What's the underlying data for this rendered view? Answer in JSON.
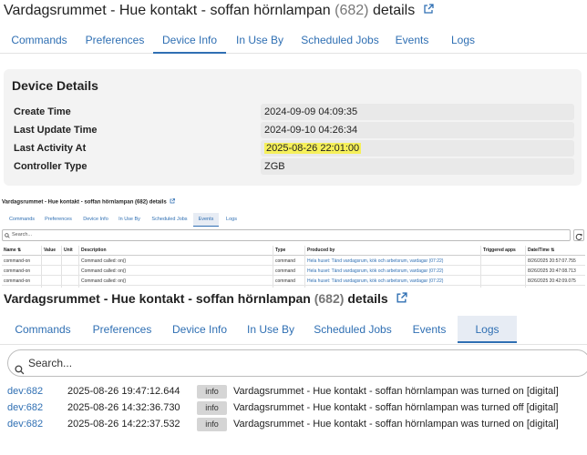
{
  "panel1": {
    "title": "Vardagsrummet - Hue kontakt - soffan hörnlampan",
    "count": "(682)",
    "title_suffix": "details",
    "tabs": [
      "Commands",
      "Preferences",
      "Device Info",
      "In Use By",
      "Scheduled Jobs",
      "Events",
      "Logs"
    ],
    "active_tab": "Device Info",
    "card_title": "Device Details",
    "details": [
      {
        "label": "Create Time",
        "value": "2024-09-09 04:09:35"
      },
      {
        "label": "Last Update Time",
        "value": "2024-09-10 04:26:34"
      },
      {
        "label": "Last Activity At",
        "value": "2025-08-26 22:01:00"
      },
      {
        "label": "Controller Type",
        "value": "ZGB"
      }
    ],
    "highlight_color": "#f6f05a"
  },
  "panel2": {
    "title": "Vardagsrummet - Hue kontakt - soffan hörnlampan (682) details",
    "tabs": [
      "Commands",
      "Preferences",
      "Device Info",
      "In Use By",
      "Scheduled Jobs",
      "Events",
      "Logs"
    ],
    "active_tab": "Events",
    "search_placeholder": "Search...",
    "columns": [
      "Name",
      "Value",
      "Unit",
      "Description",
      "Type",
      "Produced by",
      "Triggered apps",
      "Date/Time"
    ],
    "rows": [
      {
        "name": "command-on",
        "value": "",
        "unit": "",
        "description": "Command called: on()",
        "type": "command",
        "produced_by": "Hela huset: Tänd vardagsrum, kök och arbetsrum, vardagar (07:22)",
        "triggered": "",
        "datetime": "8/26/2025 20:57:07.755"
      },
      {
        "name": "command-on",
        "value": "",
        "unit": "",
        "description": "Command called: on()",
        "type": "command",
        "produced_by": "Hela huset: Tänd vardagsrum, kök och arbetsrum, vardagar (07:22)",
        "triggered": "",
        "datetime": "8/26/2025 20:47:08.713"
      },
      {
        "name": "command-on",
        "value": "",
        "unit": "",
        "description": "Command called: on()",
        "type": "command",
        "produced_by": "Hela huset: Tänd vardagsrum, kök och arbetsrum, vardagar (07:22)",
        "triggered": "",
        "datetime": "8/26/2025 20:42:09.075"
      }
    ]
  },
  "panel3": {
    "title": "Vardagsrummet - Hue kontakt - soffan hörnlampan",
    "count": "(682)",
    "title_suffix": "details",
    "tabs": [
      "Commands",
      "Preferences",
      "Device Info",
      "In Use By",
      "Scheduled Jobs",
      "Events",
      "Logs"
    ],
    "active_tab": "Logs",
    "search_placeholder": "Search...",
    "logs": [
      {
        "device": "dev:682",
        "datetime": "2025-08-26 19:47:12.644",
        "level": "info",
        "message": "Vardagsrummet - Hue kontakt - soffan hörnlampan was turned on [digital]"
      },
      {
        "device": "dev:682",
        "datetime": "2025-08-26 14:32:36.730",
        "level": "info",
        "message": "Vardagsrummet - Hue kontakt - soffan hörnlampan was turned off [digital]"
      },
      {
        "device": "dev:682",
        "datetime": "2025-08-26 14:22:37.532",
        "level": "info",
        "message": "Vardagsrummet - Hue kontakt - soffan hörnlampan was turned on [digital]"
      }
    ]
  },
  "colors": {
    "link": "#2f6fb3",
    "card_bg": "#f3f3f3",
    "badge_bg": "#d5d5d5"
  }
}
